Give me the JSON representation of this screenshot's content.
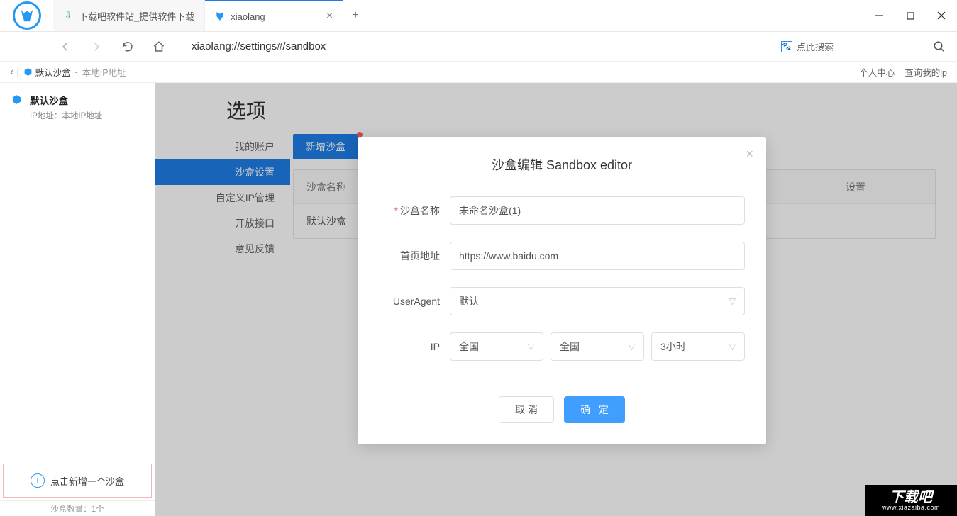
{
  "titlebar": {
    "tab1_title": "下载吧软件站_提供软件下载",
    "tab2_title": "xiaolang"
  },
  "navbar": {
    "address": "xiaolang://settings#/sandbox",
    "search_placeholder": "点此搜索"
  },
  "subheader": {
    "back_icon": "‹",
    "crumb_name": "默认沙盒",
    "crumb_sep": "-",
    "crumb_ip": "本地IP地址",
    "link_profile": "个人中心",
    "link_myip": "查询我的ip"
  },
  "leftcol": {
    "sandbox_name": "默认沙盒",
    "ip_label": "IP地址：",
    "ip_value": "本地IP地址",
    "add_button": "点击新增一个沙盒",
    "count_label": "沙盒数量：",
    "count_value": "1个"
  },
  "page": {
    "title": "选项",
    "sidenav": {
      "account": "我的账户",
      "sandbox": "沙盒设置",
      "ipmgr": "自定义IP管理",
      "api": "开放接口",
      "feedback": "意见反馈"
    },
    "toolbar": {
      "add_sandbox": "新增沙盒"
    },
    "table": {
      "header_name": "沙盒名称",
      "header_set": "设置",
      "row1_name": "默认沙盒"
    }
  },
  "dialog": {
    "title": "沙盒编辑 Sandbox editor",
    "labels": {
      "name": "沙盒名称",
      "homepage": "首页地址",
      "useragent": "UserAgent",
      "ip": "IP"
    },
    "values": {
      "name": "未命名沙盒(1)",
      "homepage": "https://www.baidu.com",
      "useragent": "默认",
      "ip_region1": "全国",
      "ip_region2": "全国",
      "ip_duration": "3小时"
    },
    "buttons": {
      "cancel": "取 消",
      "confirm": "确 定"
    }
  },
  "watermark": {
    "line1": "下载吧",
    "line2": "www.xiazaiba.com"
  }
}
